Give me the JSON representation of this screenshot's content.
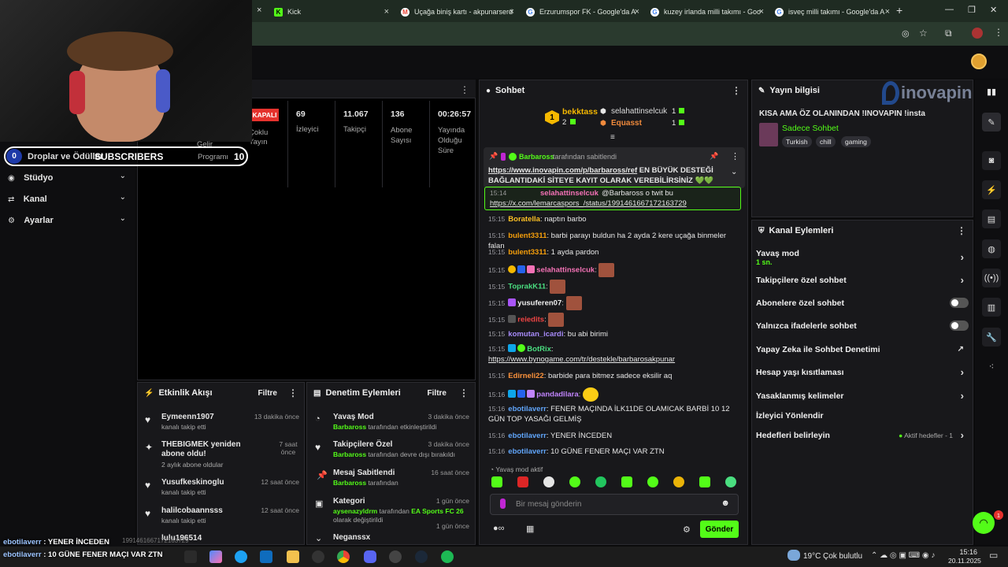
{
  "browser": {
    "tabs": [
      {
        "label": "Kick"
      },
      {
        "label": "Uçağa biniş kartı - akpunarserd"
      },
      {
        "label": "Erzurumspor FK - Google'da A"
      },
      {
        "label": "kuzey irlanda milli takımı - Goo"
      },
      {
        "label": "isveç milli takımı - Google'da A"
      }
    ],
    "new_tab": "+"
  },
  "sidebar": {
    "drops_count": "0",
    "drops_label": "Droplar ve Ödüller",
    "subscribers_label": "SUBSCRIBERS",
    "subscribers_count": "10",
    "program_label": "Programı",
    "gelir_label": "Gelir",
    "items": [
      {
        "label": "Stüdyo"
      },
      {
        "label": "Kanal"
      },
      {
        "label": "Ayarlar"
      }
    ]
  },
  "stats": {
    "status": "KAPALI",
    "multi_label": "Çoklu Yayın",
    "items": [
      {
        "value": "69",
        "label": "İzleyici"
      },
      {
        "value": "11.067",
        "label": "Takipçi"
      },
      {
        "value": "136",
        "label": "Abone Sayısı"
      },
      {
        "value": "00:26:57",
        "label": "Yayında Olduğu Süre"
      }
    ]
  },
  "activity": {
    "title": "Etkinlik Akışı",
    "filter": "Filtre",
    "items": [
      {
        "user": "Eymeenn1907",
        "desc": "kanalı takip etti",
        "time": "13 dakika önce"
      },
      {
        "user": "THEBIGMEK yeniden abone oldu!",
        "desc": "2 aylık abone oldular",
        "time": "7 saat önce"
      },
      {
        "user": "Yusufkeskinoglu",
        "desc": "kanalı takip etti",
        "time": "12 saat önce"
      },
      {
        "user": "halilcobaannsss",
        "desc": "kanalı takip etti",
        "time": "12 saat önce"
      },
      {
        "user": "lulu196514",
        "desc": "",
        "time": ""
      }
    ]
  },
  "moderation": {
    "title": "Denetim Eylemleri",
    "filter": "Filtre",
    "items": [
      {
        "title": "Yavaş Mod",
        "actor": "Barbaross",
        "desc": "tarafından etkinleştirildi",
        "time": "3 dakika önce"
      },
      {
        "title": "Takipçilere Özel",
        "actor": "Barbaross",
        "desc": "tarafından devre dışı bırakıldı",
        "time": "3 dakika önce"
      },
      {
        "title": "Mesaj Sabitlendi",
        "actor": "Barbaross",
        "desc": "tarafından",
        "time": "16 saat önce"
      },
      {
        "title": "Kategori",
        "actor": "aysenazyldrm",
        "desc": "tarafından",
        "extra": "EA Sports FC 26",
        "desc2": "olarak değiştirildi",
        "time": "1 gün önce"
      },
      {
        "title": "Neganssx",
        "actor": "",
        "desc": "",
        "time": "1 gün önce"
      }
    ]
  },
  "chat": {
    "title": "Sohbet",
    "top": [
      {
        "rank": "1",
        "name": "bekktass",
        "count": "2"
      },
      {
        "name": "selahattinselcuk",
        "count": "1"
      },
      {
        "name": "Equasst",
        "count": "1"
      }
    ],
    "pinned": {
      "by": "Barbaross",
      "by_suffix": "tarafından sabitlendi",
      "link": "https://www.inovapin.com/p/barbaross/ref",
      "text": "EN BÜYÜK DESTEĞİ BAĞLANTIDAKİ SİTEYE KAYIT OLARAK VEREBİLİRSİNİZ 💚💚"
    },
    "reply": {
      "time": "15:14",
      "user": "selahattinselcuk",
      "text": "@Barbaross o twit bu",
      "link": "https://x.com/lemarcaspors_/status/1991461667172163729"
    },
    "messages": [
      {
        "time": "15:15",
        "user": "Boratella",
        "text": "naptın barbo",
        "color": "#fbbf24"
      },
      {
        "time": "15:15",
        "user": "bulent3311",
        "text": "barbi parayı buldun ha 2 ayda 2 kere uçağa binmeler falan",
        "color": "#f59e0b"
      },
      {
        "time": "15:15",
        "user": "bulent3311",
        "text": "1 ayda pardon",
        "color": "#f59e0b"
      },
      {
        "time": "15:15",
        "user": "selahattinselcuk",
        "text": "",
        "color": "#f472b6"
      },
      {
        "time": "15:15",
        "user": "ToprakK11",
        "text": "",
        "color": "#4ade80"
      },
      {
        "time": "15:15",
        "user": "yusuferen07",
        "text": "",
        "color": "#f0f0f0"
      },
      {
        "time": "15:15",
        "user": "reiedits",
        "text": "",
        "color": "#ef4444"
      },
      {
        "time": "15:15",
        "user": "komutan_icardi",
        "text": "bu abi birimi",
        "color": "#a78bfa"
      },
      {
        "time": "15:15",
        "user": "BotRix",
        "text": "https://www.bynogame.com/tr/destekle/barbarosakpunar",
        "color": "#4ade80"
      },
      {
        "time": "15:15",
        "user": "Edirneli22",
        "text": "barbide para bitmez sadece eksilir aq",
        "color": "#fb923c"
      },
      {
        "time": "15:16",
        "user": "pandadilara",
        "text": "",
        "color": "#c084fc"
      },
      {
        "time": "15:16",
        "user": "ebotilaverr",
        "text": "FENER MAÇINDA İLK11DE OLAMICAK BARBİ 10 12 GÜN TOP YASAĞI GELMİŞ",
        "color": "#60a5fa"
      },
      {
        "time": "15:16",
        "user": "ebotilaverr",
        "text": "YENER İNCEDEN",
        "color": "#60a5fa"
      },
      {
        "time": "15:16",
        "user": "ebotilaverr",
        "text": "10 GÜNE FENER MAÇI VAR ZTN",
        "color": "#60a5fa"
      }
    ],
    "slow_mode": "Yavaş mod aktif",
    "input_placeholder": "Bir mesaj gönderin",
    "send": "Gönder"
  },
  "stream_info": {
    "title": "Yayın bilgisi",
    "stream_title": "KISA AMA ÖZ OLANINDAN !INOVAPIN !insta",
    "category": "Sadece Sohbet",
    "tags": [
      "Turkish",
      "chill",
      "gaming"
    ]
  },
  "watermark": "inovapin",
  "channel_actions": {
    "title": "Kanal Eylemleri",
    "items": [
      {
        "label": "Yavaş mod",
        "sub": "1 sn.",
        "kind": "chevron"
      },
      {
        "label": "Takipçilere özel sohbet",
        "kind": "chevron"
      },
      {
        "label": "Abonelere özel sohbet",
        "kind": "toggle"
      },
      {
        "label": "Yalnızca ifadelerle sohbet",
        "kind": "toggle"
      },
      {
        "label": "Yapay Zeka ile Sohbet Denetimi",
        "kind": "ext"
      },
      {
        "label": "Hesap yaşı kısıtlaması",
        "kind": "chevron"
      },
      {
        "label": "Yasaklanmış kelimeler",
        "kind": "chevron"
      },
      {
        "label": "İzleyici Yönlendir",
        "kind": "none"
      },
      {
        "label": "Hedefleri belirleyin",
        "sub": "Aktif hedefler - 1",
        "kind": "chevron"
      }
    ]
  },
  "overlay": {
    "line1_user": "ebotilaverr",
    "line1_text": "YENER İNCEDEN",
    "line2_user": "ebotilaverr",
    "line2_text": "10 GÜNE FENER MAÇI VAR ZTN",
    "faint": "1991461667172163729"
  },
  "support_badge": "1",
  "taskbar": {
    "temp": "19°C",
    "weather": "Çok bulutlu",
    "time": "15:16",
    "date": "20.11.2025"
  },
  "colors": {
    "accent": "#53fc18",
    "panel": "#18181b",
    "status_red": "#e5322d"
  }
}
